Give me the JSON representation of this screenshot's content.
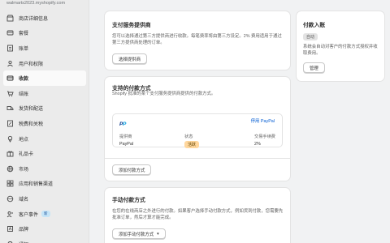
{
  "store_url": "walmarts2023.myshopify.com",
  "sidebar": {
    "items": [
      {
        "label": "商店详细信息",
        "icon": "store-icon"
      },
      {
        "label": "套餐",
        "icon": "plan-icon"
      },
      {
        "label": "账单",
        "icon": "billing-icon"
      },
      {
        "label": "用户和权限",
        "icon": "users-icon"
      },
      {
        "label": "收款",
        "icon": "payments-icon",
        "active": true
      },
      {
        "label": "结账",
        "icon": "checkout-icon"
      },
      {
        "label": "发货和配送",
        "icon": "shipping-icon"
      },
      {
        "label": "税费和关税",
        "icon": "taxes-icon"
      },
      {
        "label": "地点",
        "icon": "location-icon"
      },
      {
        "label": "礼品卡",
        "icon": "gift-card-icon"
      },
      {
        "label": "市场",
        "icon": "markets-icon"
      },
      {
        "label": "应用和销售渠道",
        "icon": "apps-icon"
      },
      {
        "label": "域名",
        "icon": "domains-icon"
      },
      {
        "label": "客户事件",
        "icon": "customer-events-icon",
        "badge": "新"
      },
      {
        "label": "品牌",
        "icon": "brand-icon"
      },
      {
        "label": "通知",
        "icon": "notifications-icon"
      }
    ]
  },
  "third_party": {
    "title": "支付服务提供商",
    "description": "您可以选择通过第三方提供商进行收款。每笔费率将由第三方设定。2% 费用适用于通过第三方提供商处理的订单。",
    "button": "选择提供商"
  },
  "supported": {
    "title": "支持的付款方式",
    "description": "Shopify 批准的某个支付服务提供商提供的付款方式。",
    "provider_name": "PayPal",
    "deactivate_link": "停用 PayPal",
    "columns": [
      "提供商",
      "状态",
      "交易手续费"
    ],
    "row": {
      "provider": "PayPal",
      "status": "活跃",
      "fee": "2%"
    },
    "button": "添加付款方式"
  },
  "manual": {
    "title": "手动付款方式",
    "description": "在您的在线商店之外进行的付款。如果客户选择手动付款方式，例如货到付款，您需要先批准订单，然后才算才能完成。",
    "button": "添加手动付款方式"
  },
  "authorization": {
    "title": "付款入账",
    "status": "自动",
    "description": "系统会自动对客户的付款方式授权并收取费用。",
    "button": "管理"
  },
  "colors": {
    "accent": "#005bd3",
    "active_bg": "#fafafa",
    "status_badge": "#ffd79d"
  }
}
